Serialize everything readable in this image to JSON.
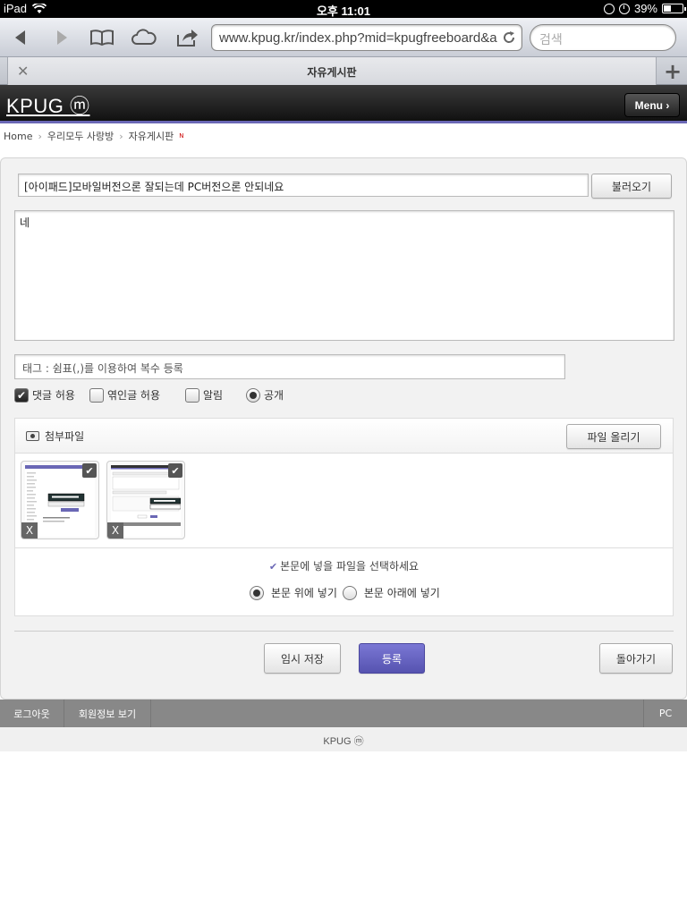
{
  "status_bar": {
    "device": "iPad",
    "time": "오후 11:01",
    "battery": "39%",
    "battery_level": 0.39
  },
  "browser": {
    "url": "www.kpug.kr/index.php?mid=kpugfreeboard&a",
    "search_placeholder": "검색",
    "tab_title": "자유게시판"
  },
  "site": {
    "logo": "KPUG ⓜ",
    "menu_label": "Menu ›"
  },
  "breadcrumb": {
    "items": [
      "Home",
      "우리모두 사랑방",
      "자유게시판"
    ],
    "new_badge": "N"
  },
  "form": {
    "title_value": "[아이패드]모바일버전으론 잘되는데 PC버전으론 안되네요",
    "load_label": "불러오기",
    "content_value": "네",
    "tag_placeholder": "태그 : 쉼표(,)를 이용하여 복수 등록",
    "options": {
      "comments": "댓글 허용",
      "trackback": "엮인글 허용",
      "notify": "알림",
      "public": "공개"
    }
  },
  "attachments": {
    "title": "첨부파일",
    "upload_label": "파일 올리기",
    "delete_label": "X",
    "select_hint": "본문에 넣을 파일을 선택하세요",
    "insert_above": "본문 위에 넣기",
    "insert_below": "본문 아래에 넣기"
  },
  "actions": {
    "temp_save": "임시 저장",
    "submit": "등록",
    "back": "돌아가기"
  },
  "footer": {
    "logout": "로그아웃",
    "member_info": "회원정보 보기",
    "pc": "PC",
    "copyright": "KPUG ⓜ"
  },
  "colors": {
    "accent": "#6a67b5",
    "submit": "#5e5bbd"
  }
}
